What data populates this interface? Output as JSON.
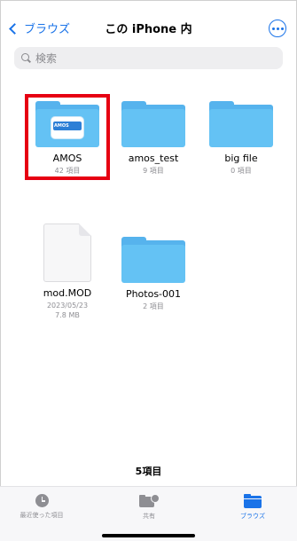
{
  "nav": {
    "back_label": "ブラウズ",
    "title": "この iPhone 内",
    "more_icon": "ellipsis-circle-icon"
  },
  "search": {
    "placeholder": "検索",
    "value": ""
  },
  "items": [
    {
      "name": "AMOS",
      "meta": "42 項目",
      "kind": "folder",
      "thumbnail_text": "AMOS",
      "highlighted": true
    },
    {
      "name": "amos_test",
      "meta": "9 項目",
      "kind": "folder"
    },
    {
      "name": "big file",
      "meta": "0 項目",
      "kind": "folder"
    },
    {
      "name": "mod.MOD",
      "meta_date": "2023/05/23",
      "meta_size": "7.8 MB",
      "kind": "file"
    },
    {
      "name": "Photos-001",
      "meta": "2 項目",
      "kind": "folder"
    }
  ],
  "footer": {
    "count": "5項目"
  },
  "tabbar": {
    "recent": "最近使った項目",
    "shared": "共有",
    "browse": "ブラウズ",
    "active": "browse"
  },
  "colors": {
    "accent": "#1a73e8",
    "folder": "#64c2f4",
    "highlight": "#e60012"
  }
}
